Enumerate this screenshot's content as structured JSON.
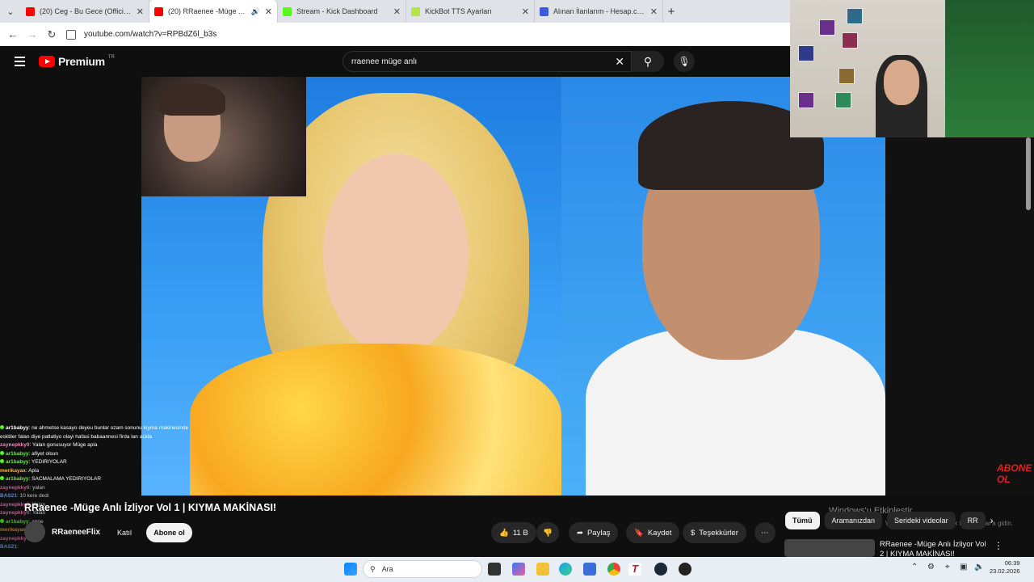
{
  "browser": {
    "tabs": [
      {
        "title": "(20) Ceg - Bu Gece (Official Vid",
        "color": "#ff0000"
      },
      {
        "title": "(20) RRaenee -Müge Anlı İz",
        "color": "#ff0000",
        "active": true
      },
      {
        "title": "Stream - Kick Dashboard",
        "color": "#53fc18"
      },
      {
        "title": "KickBot TTS Ayarları",
        "color": "#b7e34a"
      },
      {
        "title": "Alınan İlanlarım - Hesap.com.tr",
        "color": "#3b5bdb"
      }
    ],
    "url": "youtube.com/watch?v=RPBdZ6l_b3s"
  },
  "youtube": {
    "brand": "Premium",
    "region": "TR",
    "search_query": "rraenee müge anlı"
  },
  "video": {
    "title": "RRaenee -Müge Anlı İzliyor Vol 1 | KIYMA MAKİNASI!",
    "channel": "RRaeneeFlix",
    "join_label": "Katıl",
    "subscribe_label": "Abone ol",
    "likes": "11 B",
    "share_label": "Paylaş",
    "save_label": "Kaydet",
    "thanks_label": "Teşekkürler",
    "overlay_logo": "ABONE OL"
  },
  "chat": [
    {
      "user": "ar1babyy",
      "text": ": ne ahmetse kasayo deyeu bunlar ozam sonunu kıyma makinesinde"
    },
    {
      "user": "",
      "text": "esktiler falan diye patlatiyo olayi hafasi babaannesi firda lan acida"
    },
    {
      "user": "zaynepkky0",
      "text": ": Yalan gonusuyor Müge apla"
    },
    {
      "user": "ar1babyy",
      "text": ": afiyet olsun"
    },
    {
      "user": "ar1babyy",
      "text": ": YEDIRIYOLAR"
    },
    {
      "user": "merikayax",
      "text": ": Apla"
    },
    {
      "user": "ar1babyy",
      "text": ": SACMALAMA YEDIRIYOLAR"
    },
    {
      "user": "zaynepkky0",
      "text": ": yalan"
    },
    {
      "user": "BAS21",
      "text": ": 10 kere dedi"
    },
    {
      "user": "zaynepkky0",
      "text": ": Yalan"
    },
    {
      "user": "zaynepkky0",
      "text": ": Yalan"
    },
    {
      "user": "ar1babyy",
      "text": ": anne"
    },
    {
      "user": "merikayax",
      "text": ": "
    },
    {
      "user": "zaynepkky0",
      "text": ": "
    },
    {
      "user": "BAS21",
      "text": ": "
    }
  ],
  "sidebar": {
    "chips": [
      "Tümü",
      "Aramanızdan",
      "Serideki videolar",
      "RR"
    ],
    "windows_activation": "Windows'u Etkinleştir",
    "windows_activation_sub": "Windows'u etkinleştirmek için Ayarlar'a gidin.",
    "recommended_title": "RRaenee -Müge Anlı İzliyor Vol 2 | KIYMA MAKİNASI!"
  },
  "taskbar": {
    "search_placeholder": "Ara",
    "time": "06:39",
    "date": "23.02.2026"
  }
}
